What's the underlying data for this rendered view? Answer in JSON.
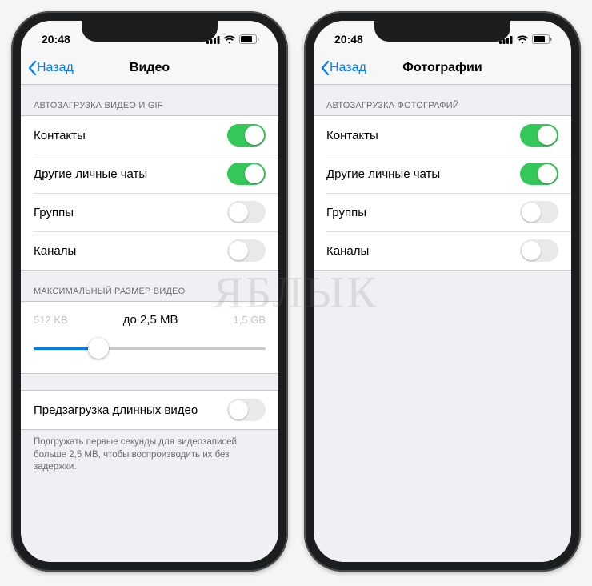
{
  "watermark": "ЯБЛЫК",
  "status": {
    "time": "20:48"
  },
  "back_label": "Назад",
  "phones": [
    {
      "title": "Видео",
      "section1_header": "АВТОЗАГРУЗКА ВИДЕО И GIF",
      "rows": [
        {
          "label": "Контакты",
          "on": true
        },
        {
          "label": "Другие личные чаты",
          "on": true
        },
        {
          "label": "Группы",
          "on": false
        },
        {
          "label": "Каналы",
          "on": false
        }
      ],
      "slider": {
        "header": "МАКСИМАЛЬНЫЙ РАЗМЕР ВИДЕО",
        "min": "512 KB",
        "max": "1,5 GB",
        "current": "до 2,5 MB",
        "percent": 28
      },
      "preload": {
        "label": "Предзагрузка длинных видео",
        "on": false
      },
      "footer": "Подгружать первые секунды для видеозаписей больше 2,5 MB, чтобы воспроизводить их без задержки."
    },
    {
      "title": "Фотографии",
      "section1_header": "АВТОЗАГРУЗКА ФОТОГРАФИЙ",
      "rows": [
        {
          "label": "Контакты",
          "on": true
        },
        {
          "label": "Другие личные чаты",
          "on": true
        },
        {
          "label": "Группы",
          "on": false
        },
        {
          "label": "Каналы",
          "on": false
        }
      ]
    }
  ]
}
